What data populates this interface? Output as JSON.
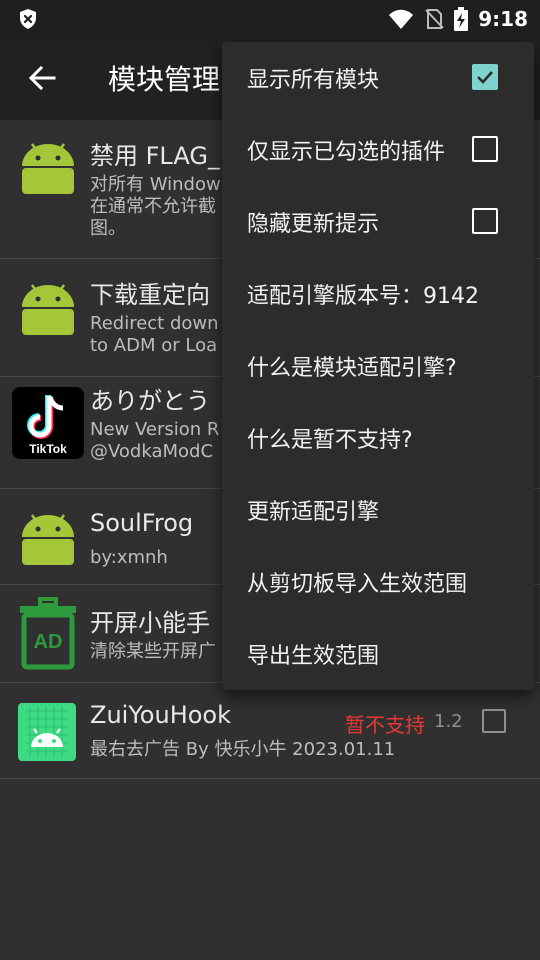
{
  "status_bar": {
    "time": "9:18",
    "icons": [
      "shield-x-icon",
      "wifi-icon",
      "no-sim-icon",
      "battery-charging-icon"
    ]
  },
  "app_bar": {
    "back_icon": "arrow-left-icon",
    "title": "模块管理"
  },
  "modules": [
    {
      "icon": "android-icon",
      "name": "禁用 FLAG_",
      "desc": "对所有 Window\n在通常不允许截\n图。"
    },
    {
      "icon": "android-icon",
      "name": "下载重定向",
      "desc": "Redirect down\nto ADM or Loa"
    },
    {
      "icon": "tiktok-icon",
      "name": "ありがとう",
      "desc": "New Version R\n@VodkaModC"
    },
    {
      "icon": "android-icon",
      "name": "SoulFrog",
      "desc": "by:xmnh"
    },
    {
      "icon": "ad-trash-icon",
      "name": "开屏小能手",
      "desc": "清除某些开屏广"
    },
    {
      "icon": "android-green-icon",
      "name": "ZuiYouHook",
      "desc": "最右去广告 By 快乐小牛 2023.01.11",
      "unsupported": "暂不支持",
      "version": "1.2",
      "checked": false
    }
  ],
  "menu": {
    "items": [
      {
        "label": "显示所有模块",
        "checkbox": true,
        "checked": true
      },
      {
        "label": "仅显示已勾选的插件",
        "checkbox": true,
        "checked": false
      },
      {
        "label": "隐藏更新提示",
        "checkbox": true,
        "checked": false
      },
      {
        "label": "适配引擎版本号：9142",
        "checkbox": false
      },
      {
        "label": "什么是模块适配引擎?",
        "checkbox": false
      },
      {
        "label": "什么是暂不支持?",
        "checkbox": false
      },
      {
        "label": "更新适配引擎",
        "checkbox": false
      },
      {
        "label": "从剪切板导入生效范围",
        "checkbox": false
      },
      {
        "label": "导出生效范围",
        "checkbox": false
      }
    ]
  },
  "colors": {
    "background": "#303030",
    "app_bar": "#212121",
    "menu": "#2c2c2c",
    "accent_check": "#7fd3cc",
    "unsupported_red": "#e53935",
    "android_green": "#a4c639"
  }
}
